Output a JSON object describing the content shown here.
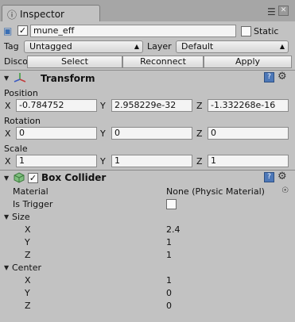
{
  "tab": {
    "title": "Inspector"
  },
  "header": {
    "active_checked": "✓",
    "object_name": "mune_eff",
    "static_label": "Static",
    "tag_label": "Tag",
    "tag_value": "Untagged",
    "layer_label": "Layer",
    "layer_value": "Default",
    "prefab_label": "Discor",
    "select_label": "Select",
    "reconnect_label": "Reconnect",
    "apply_label": "Apply"
  },
  "transform": {
    "title": "Transform",
    "position_label": "Position",
    "rotation_label": "Rotation",
    "scale_label": "Scale",
    "axes": [
      "X",
      "Y",
      "Z"
    ],
    "position": [
      "-0.784752",
      "2.958229e-32",
      "-1.332268e-16"
    ],
    "rotation": [
      "0",
      "0",
      "0"
    ],
    "scale": [
      "1",
      "1",
      "1"
    ]
  },
  "box_collider": {
    "title": "Box Collider",
    "material_label": "Material",
    "material_value": "None (Physic Material)",
    "is_trigger_label": "Is Trigger",
    "size_label": "Size",
    "center_label": "Center",
    "axes": [
      "X",
      "Y",
      "Z"
    ],
    "size": [
      "2.4",
      "1",
      "1"
    ],
    "center": [
      "1",
      "0",
      "0"
    ]
  },
  "icons": {
    "tab": "inspector-icon",
    "object": "cube-icon",
    "transform": "axes-icon",
    "collider": "collider-icon",
    "help": "help-icon",
    "gear": "gear-icon",
    "menu": "context-menu-icon",
    "close": "close-icon"
  },
  "colors": {
    "panel": "#c2c2c2",
    "tabbar": "#a6a6a6",
    "help": "#4d78b8"
  }
}
